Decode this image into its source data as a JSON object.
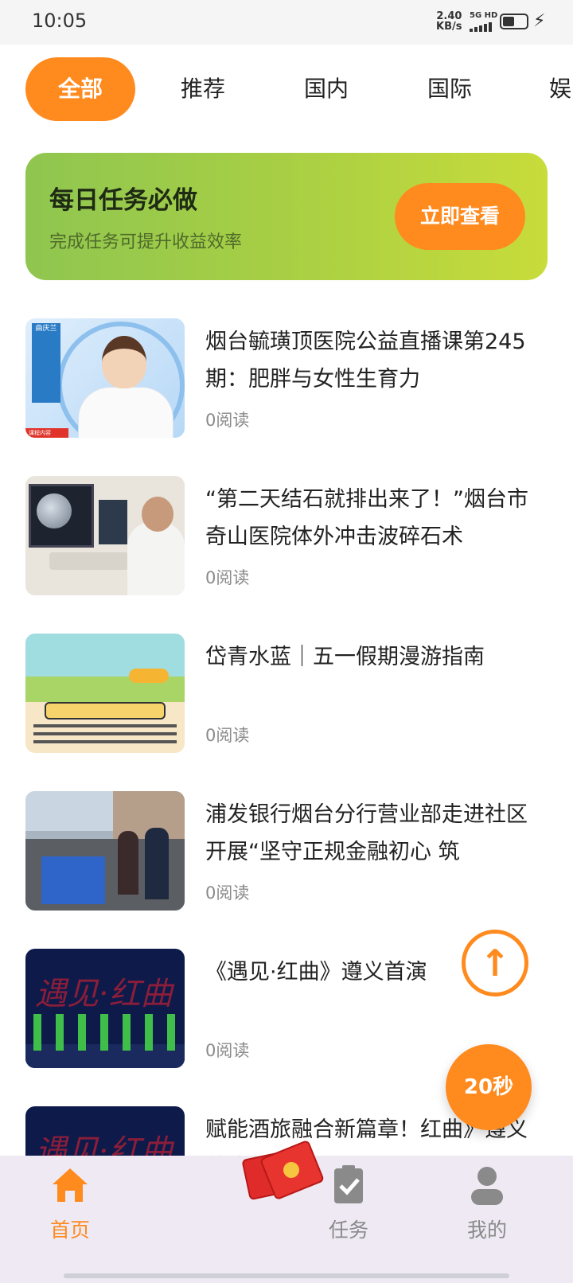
{
  "status": {
    "time": "10:05",
    "speed_value": "2.40",
    "speed_unit": "KB/s",
    "network": "5G HD"
  },
  "tabs": [
    {
      "label": "全部",
      "active": true
    },
    {
      "label": "推荐"
    },
    {
      "label": "国内"
    },
    {
      "label": "国际"
    },
    {
      "label": "娱"
    }
  ],
  "task_banner": {
    "title": "每日任务必做",
    "subtitle": "完成任务可提升收益效率",
    "button": "立即查看"
  },
  "news": [
    {
      "title": "烟台毓璜顶医院公益直播课第245期：肥胖与女性生育力",
      "reads": "0阅读",
      "thumb_text": {
        "name": "曲庆兰",
        "tag": "课程内容"
      }
    },
    {
      "title": "“第二天结石就排出来了！”烟台市奇山医院体外冲击波碎石术",
      "reads": "0阅读"
    },
    {
      "title": "岱青水蓝｜五一假期漫游指南",
      "reads": "0阅读"
    },
    {
      "title": "浦发银行烟台分行营业部走进社区开展“坚守正规金融初心 筑",
      "reads": "0阅读"
    },
    {
      "title": "《遇见·红曲》遵义首演",
      "reads": "0阅读",
      "thumb_text": "遇见·红曲"
    },
    {
      "title": "赋能酒旅融合新篇章！红曲》遵义首演",
      "reads": "",
      "thumb_text": "遇见·红曲"
    }
  ],
  "floating": {
    "scroll_top_icon": "arrow-up-icon",
    "timer": "20秒"
  },
  "bottom_nav": [
    {
      "label": "首页",
      "icon": "home-icon",
      "active": true
    },
    {
      "label": "任务",
      "icon": "clipboard-check-icon"
    },
    {
      "label": "我的",
      "icon": "user-icon"
    }
  ],
  "colors": {
    "accent": "#ff8a1e",
    "banner_start": "#8fc650",
    "banner_end": "#c8dc3a"
  }
}
